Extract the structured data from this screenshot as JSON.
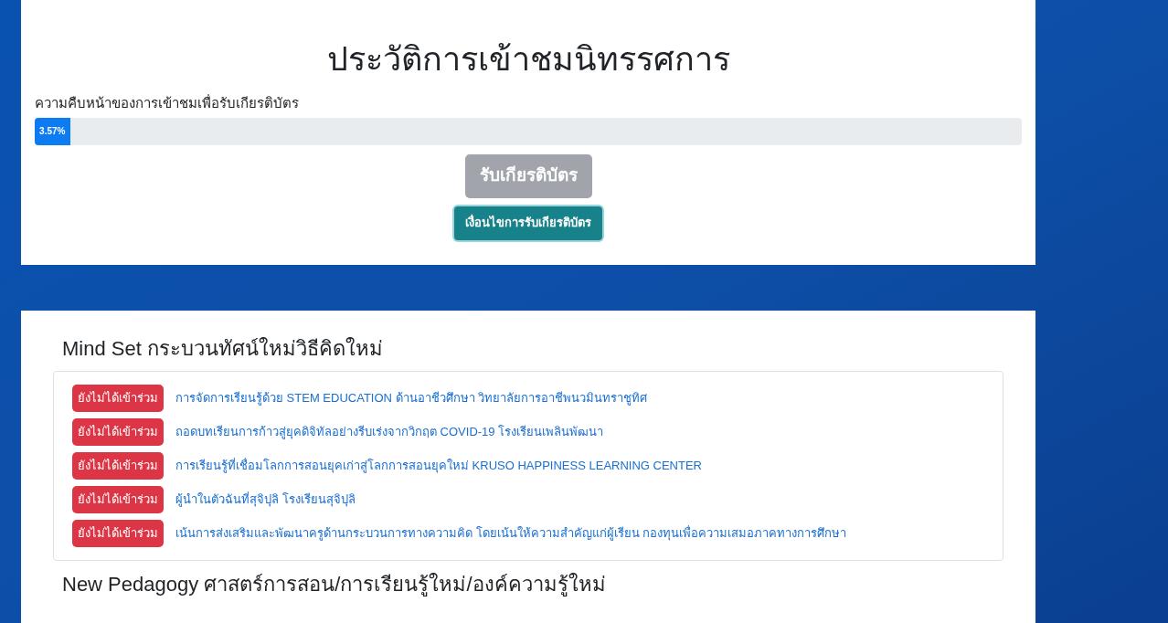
{
  "history": {
    "title": "ประวัติการเข้าชมนิทรรศการ",
    "progress_label": "ความคืบหน้าของการเข้าชมเพื่อรับเกียรติบัตร",
    "progress": {
      "level": 0.0357,
      "reading": "3.57%"
    },
    "certificate_button": {
      "label": "รับเกียรติบัตร",
      "disabled": true
    },
    "conditions_button": {
      "label": "เงื่อนไขการรับเกียรติบัตร"
    }
  },
  "sections": [
    {
      "title": "Mind Set กระบวนทัศน์ใหม่วิธีคิดใหม่",
      "items": [
        {
          "status": "ยังไม่ได้เข้าร่วม",
          "joined": false,
          "title": "การจัดการเรียนรู้ด้วย STEM EDUCATION ด้านอาชีวศึกษา วิทยาลัยการอาชีพนวมินทราชูทิศ"
        },
        {
          "status": "ยังไม่ได้เข้าร่วม",
          "joined": false,
          "title": "ถอดบทเรียนการก้าวสู่ยุคดิจิทัลอย่างรีบเร่งจากวิกฤต COVID-19 โรงเรียนเพลินพัฒนา"
        },
        {
          "status": "ยังไม่ได้เข้าร่วม",
          "joined": false,
          "title": "การเรียนรู้ที่เชื่อมโลกการสอนยุคเก่าสู่โลกการสอนยุคใหม่ KRUSO HAPPINESS LEARNING CENTER"
        },
        {
          "status": "ยังไม่ได้เข้าร่วม",
          "joined": false,
          "title": "ผู้นำในตัวฉันที่สุจิปุลิ โรงเรียนสุจิปุลิ"
        },
        {
          "status": "ยังไม่ได้เข้าร่วม",
          "joined": false,
          "title": "เน้นการส่งเสริมและพัฒนาครูด้านกระบวนการทางความคิด โดยเน้นให้ความสำคัญแก่ผู้เรียน กองทุนเพื่อความเสมอภาคทางการศึกษา"
        }
      ]
    },
    {
      "title": "New Pedagogy ศาสตร์การสอน/การเรียนรู้ใหม่/องค์ความรู้ใหม่"
    }
  ]
}
